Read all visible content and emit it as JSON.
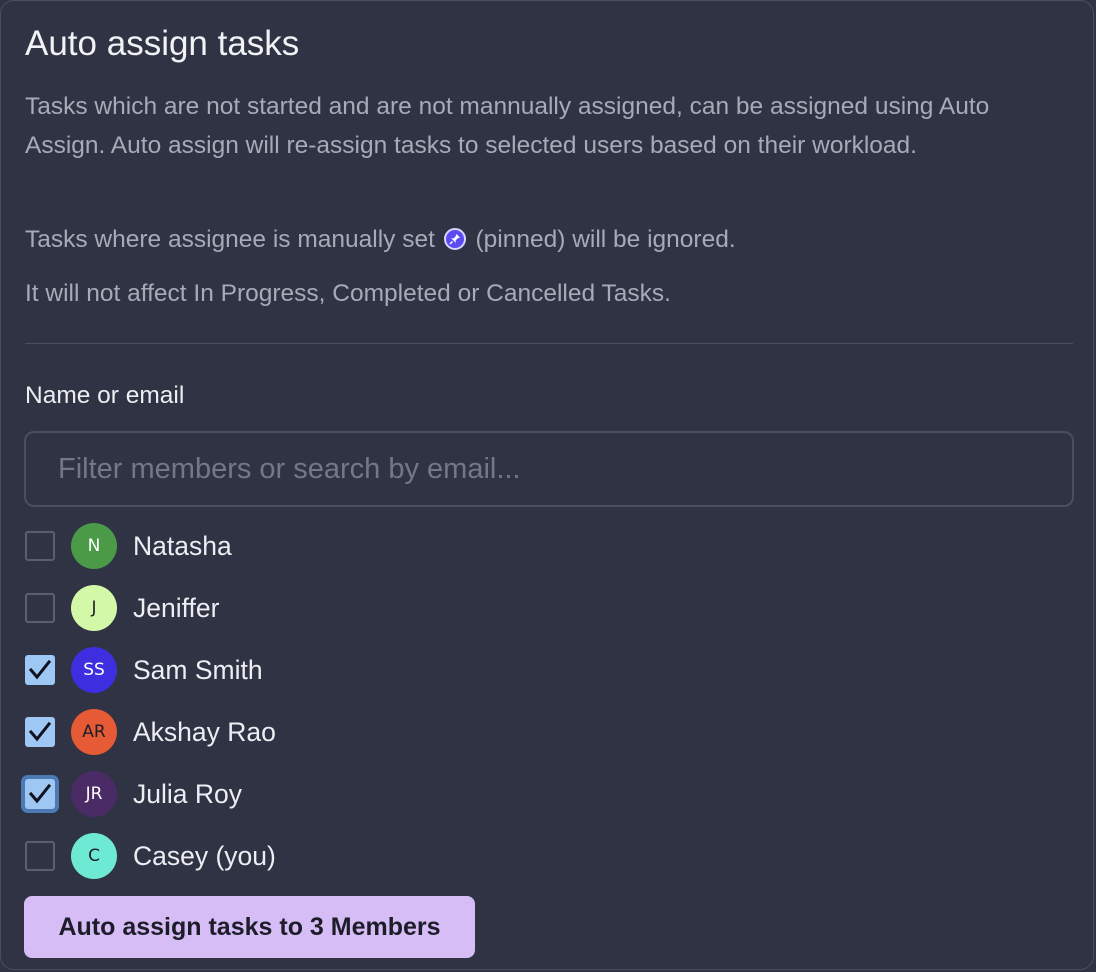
{
  "dialog": {
    "title": "Auto assign tasks",
    "description": "Tasks which are not started and are not mannually assigned, can be assigned using Auto Assign. Auto assign will re-assign tasks to selected users based on their workload.",
    "pinned_note_before": "Tasks where assignee is manually set",
    "pinned_note_after": "(pinned) will be ignored.",
    "pin_icon": "pin-icon",
    "scope_note": "It will not affect In Progress, Completed or Cancelled Tasks."
  },
  "filter": {
    "label": "Name or email",
    "value": "",
    "placeholder": "Filter members or search by email..."
  },
  "members": [
    {
      "initials": "N",
      "name": "Natasha",
      "checked": false,
      "avatar_color": "#4b9a48",
      "initials_color": "#ffffff"
    },
    {
      "initials": "J",
      "name": "Jeniffer",
      "checked": false,
      "avatar_color": "#d3f8a8",
      "initials_color": "#1c1d29"
    },
    {
      "initials": "SS",
      "name": "Sam Smith",
      "checked": true,
      "avatar_color": "#3d2ee0",
      "initials_color": "#ffffff"
    },
    {
      "initials": "AR",
      "name": "Akshay Rao",
      "checked": true,
      "avatar_color": "#e65a35",
      "initials_color": "#1c1d29"
    },
    {
      "initials": "JR",
      "name": "Julia Roy",
      "checked": true,
      "avatar_color": "#4a2b66",
      "initials_color": "#ffffff"
    },
    {
      "initials": "C",
      "name": "Casey (you)",
      "checked": false,
      "avatar_color": "#6ee9d3",
      "initials_color": "#1c1d29"
    }
  ],
  "action": {
    "label": "Auto assign tasks to 3 Members"
  },
  "colors": {
    "background": "#2f3343",
    "checkbox_checked": "#9fc7f3",
    "button": "#d6bdf5",
    "pin_badge": "#5b4bf0"
  }
}
